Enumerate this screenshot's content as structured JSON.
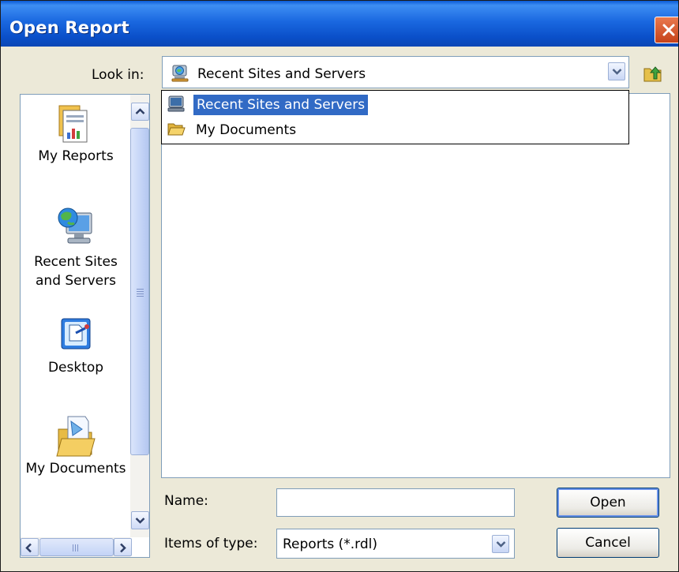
{
  "window": {
    "title": "Open Report"
  },
  "look_in": {
    "label": "Look in:",
    "value": "Recent Sites and Servers",
    "value_icon": "server-globe-icon",
    "options": [
      {
        "label": "Recent Sites and Servers",
        "icon": "server-icon",
        "selected": true
      },
      {
        "label": "My Documents",
        "icon": "folder-open-icon",
        "selected": false
      }
    ]
  },
  "places_bar": {
    "items": [
      {
        "label": "My Reports",
        "icon": "reports-folder-icon"
      },
      {
        "label": "Recent Sites and Servers",
        "icon": "globe-monitor-icon"
      },
      {
        "label": "Desktop",
        "icon": "desktop-icon"
      },
      {
        "label": "My Documents",
        "icon": "my-documents-icon"
      }
    ]
  },
  "form": {
    "name_label": "Name:",
    "name_value": "",
    "type_label": "Items of type:",
    "type_value": "Reports (*.rdl)"
  },
  "buttons": {
    "open": "Open",
    "cancel": "Cancel"
  },
  "colors": {
    "titlebar": "#0a5ad6",
    "selection": "#316ac5",
    "dialog_bg": "#ece9d8"
  }
}
